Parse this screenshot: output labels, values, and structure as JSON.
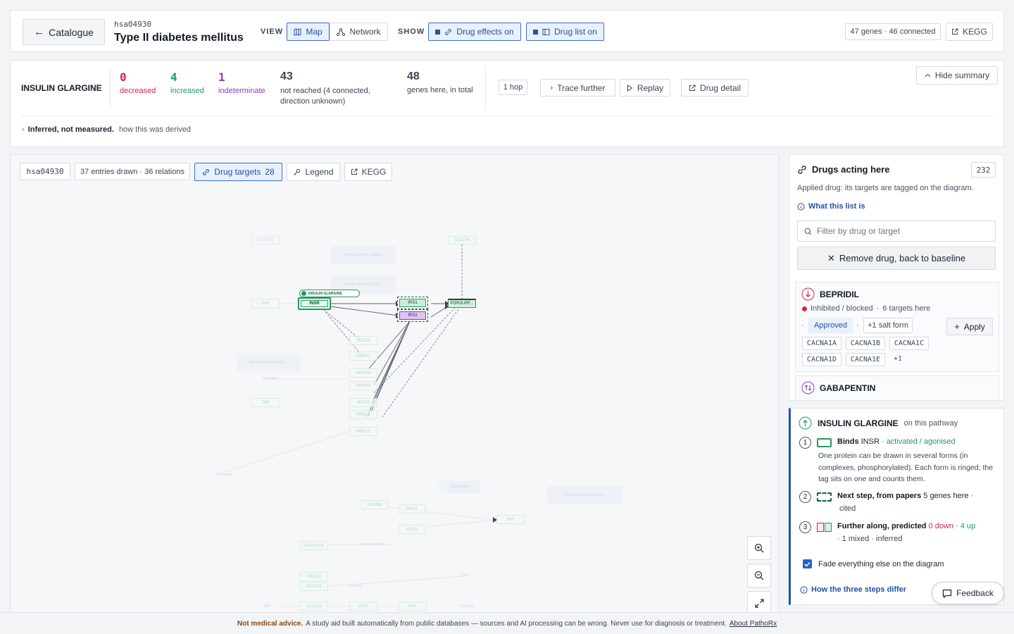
{
  "header": {
    "back_label": "Catalogue",
    "pathway_id": "hsa04930",
    "pathway_title": "Type II diabetes mellitus",
    "view_label": "VIEW",
    "view_map": "Map",
    "view_network": "Network",
    "show_label": "SHOW",
    "drug_effects": "Drug effects on",
    "drug_list": "Drug list on",
    "gene_count": "47 genes · 46 connected",
    "kegg": "KEGG"
  },
  "summary": {
    "drug_name": "INSULIN GLARGINE",
    "stats": [
      {
        "value": "0",
        "label": "decreased",
        "color": "#d3294a"
      },
      {
        "value": "4",
        "label": "increased",
        "color": "#1f9a5d"
      },
      {
        "value": "1",
        "label": "indeterminate",
        "color": "#8b3cc4"
      },
      {
        "value": "43",
        "label": "not reached (4 connected, direction unknown)",
        "color": "#3a4654"
      },
      {
        "value": "48",
        "label": "genes here, in total",
        "color": "#3a4654"
      }
    ],
    "hop": "1 hop",
    "trace_further": "Trace further",
    "replay": "Replay",
    "drug_detail": "Drug detail",
    "hide_summary": "Hide summary",
    "inferred_bold": "Inferred, not measured.",
    "inferred_text": "how this was derived"
  },
  "map": {
    "id": "hsa04930",
    "entries": "37 entries drawn · 36 relations",
    "drug_targets": "Drug targets",
    "drug_targets_count": "28",
    "legend": "Legend",
    "kegg": "KEGG",
    "insulin_tag": "INSULIN GLARGINE",
    "genes": {
      "insr": "INSR",
      "irs1a": "IRS1",
      "irs1b": "IRS1",
      "pik3r": "PI3R3URF...",
      "adipoq": "ADIPOQ",
      "slc2a4": "SLC2A4",
      "ins": "INS",
      "socs4": "SOCS4",
      "mapk1": "MAPK1",
      "mapk8": "MAPK8",
      "mapk9": "MAPK9",
      "tnf": "TNF",
      "mtor": "MTOR",
      "prkcd": "PRKCD",
      "prkce": "PRKCE",
      "mapk8b": "MAPK8",
      "pdx1": "PDX1",
      "mafa": "MAFA",
      "ins2": "INS",
      "cacna1a": "CACNA1A",
      "abcc8": "ABCC8",
      "kcnj11": "KCNJ11",
      "slc2a2": "SLC2A2",
      "gck": "GCK",
      "hk1": "HK1"
    },
    "ghosts": {
      "g1": "Adipocytokine signa...",
      "g2": "Insulin signaling pa...",
      "g3": "Mitochondrial dysfu...",
      "g4": "Maturity onset diabet...",
      "g5": "Glycolysis"
    },
    "notes": {
      "n1": "Palmitate",
      "n2": "D-Glucose",
      "n3": "Insulin secretion",
      "n4": "Ca2+",
      "n5": "Glucose",
      "n6": "ATP",
      "n7": "Pyruvate",
      "n8": "D-Glucose"
    }
  },
  "drugs_panel": {
    "title": "Drugs acting here",
    "count": "232",
    "subtitle": "Applied drug: its targets are tagged on the diagram.",
    "what_list": "What this list is",
    "filter_placeholder": "Filter by drug or target",
    "remove": "Remove drug, back to baseline",
    "bepridil": {
      "name": "BEPRIDIL",
      "action": "Inhibited / blocked",
      "targets": "6 targets here",
      "approved": "Approved",
      "salt": "+1 salt form",
      "apply": "Apply",
      "genes": [
        "CACNA1A",
        "CACNA1B",
        "CACNA1C",
        "CACNA1D",
        "CACNA1E"
      ],
      "more": "+1"
    },
    "gabapentin": {
      "name": "GABAPENTIN"
    }
  },
  "insulin_panel": {
    "name": "INSULIN GLARGINE",
    "suffix": "on this pathway",
    "s1_bold": "Binds",
    "s1_gene": "INSR",
    "s1_sep": " · ",
    "s1_effect": "activated / agonised",
    "s1_desc": "One protein can be drawn in several forms (in complexes, phosphorylated). Each form is ringed; the tag sits on one and counts them.",
    "s2_bold": "Next step, from papers",
    "s2_rest": "5 genes here ·",
    "s2_cited": "cited",
    "s3_bold": "Further along, predicted",
    "s3_down": "0 down",
    "s3_sep": " · ",
    "s3_up": "4 up",
    "s3_rest": "· 1 mixed · inferred",
    "fade": "Fade everything else on the diagram",
    "how": "How the three steps differ",
    "feedback": "Feedback"
  },
  "footer": {
    "bold": "Not medical advice.",
    "text": "A study aid built automatically from public databases — sources and AI processing can be wrong. Never use for diagnosis or treatment.",
    "link": "About PathoRx"
  },
  "colors": {
    "accent": "#2452a8",
    "increased": "#1f9a5d",
    "decreased": "#d3294a",
    "indeterminate": "#8b3cc4"
  }
}
